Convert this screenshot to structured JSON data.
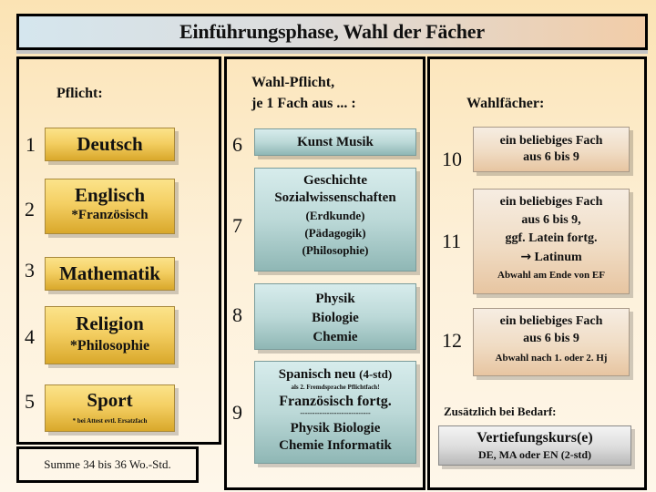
{
  "title": "Einführungsphase, Wahl der Fächer",
  "pflicht": {
    "heading": "Pflicht:",
    "items": [
      {
        "number": "1",
        "subject": "Deutsch",
        "note": ""
      },
      {
        "number": "2",
        "subject": "Englisch",
        "note": "*Französisch"
      },
      {
        "number": "3",
        "subject": "Mathematik",
        "note": ""
      },
      {
        "number": "4",
        "subject": "Religion",
        "note": "*Philosophie"
      },
      {
        "number": "5",
        "subject": "Sport",
        "note": "* bei Attest evtl. Ersatzfach"
      }
    ],
    "summe": "Summe 34 bis 36 Wo.-Std."
  },
  "wahlpflicht": {
    "heading_line1": "Wahl-Pflicht,",
    "heading_line2": "je 1 Fach aus ... :",
    "items": [
      {
        "number": "6",
        "lines": [
          "Kunst  Musik"
        ]
      },
      {
        "number": "7",
        "lines": [
          "Geschichte",
          "Sozialwissenschaften",
          "(Erdkunde)",
          "(Pädagogik)",
          "(Philosophie)"
        ]
      },
      {
        "number": "8",
        "lines": [
          "Physik",
          "Biologie",
          "Chemie"
        ]
      },
      {
        "number": "9",
        "spanisch": "Spanisch neu",
        "spanisch_hours": "(4-std)",
        "spanisch_note": "als 2. Fremdsprache Pflichtfach!",
        "franz": "Französisch fortg.",
        "separator": "-----------------------------",
        "science_line1": "Physik  Biologie",
        "science_line2": "Chemie  Informatik"
      }
    ]
  },
  "wahlfaecher": {
    "heading": "Wahlfächer:",
    "items": [
      {
        "number": "10",
        "lines": [
          "ein beliebiges Fach",
          "aus 6 bis 9"
        ],
        "note": ""
      },
      {
        "number": "11",
        "lines": [
          "ein beliebiges Fach",
          "aus 6 bis 9,",
          "ggf. Latein fortg."
        ],
        "arrow_icon": "→",
        "arrow_text": "Latinum",
        "note": "Abwahl am Ende von EF"
      },
      {
        "number": "12",
        "lines": [
          "ein beliebiges Fach",
          "aus 6 bis 9"
        ],
        "note": "Abwahl nach 1. oder 2. Hj"
      }
    ],
    "extra_heading": "Zusätzlich bei Bedarf:",
    "extra_title": "Vertiefungskurs(e)",
    "extra_detail": "DE, MA oder EN  (2-std)"
  }
}
